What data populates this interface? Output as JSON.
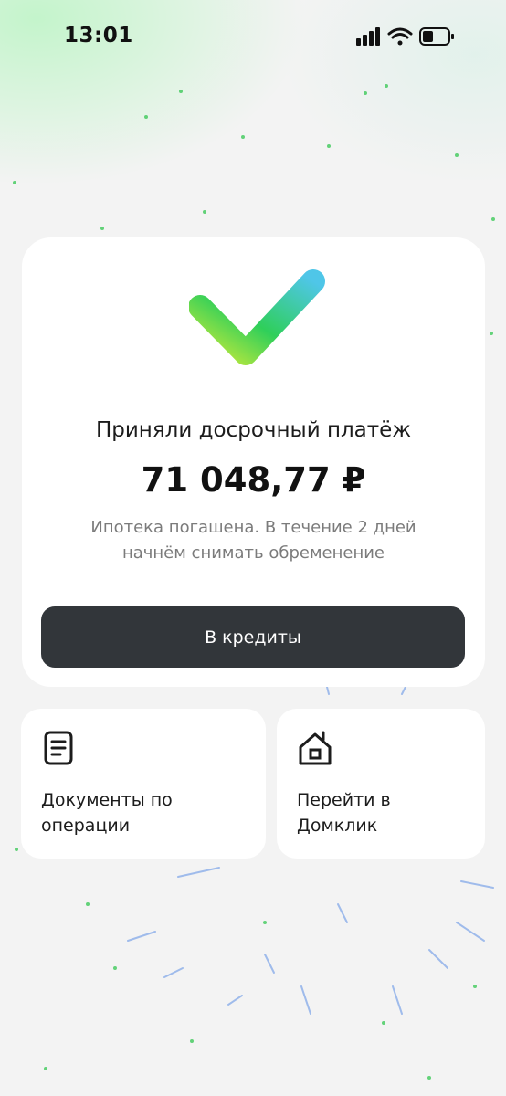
{
  "status_bar": {
    "time": "13:01",
    "icons": [
      "cellular-signal-icon",
      "wifi-icon",
      "battery-icon"
    ]
  },
  "payment_card": {
    "icon": "checkmark-icon",
    "title": "Приняли досрочный платёж",
    "amount": "71 048,77 ₽",
    "description_line1": "Ипотека погашена. В течение 2 дней",
    "description_line2": "начнём снимать обременение",
    "button_label": "В кредиты"
  },
  "tiles": [
    {
      "icon": "document-icon",
      "label_line1": "Документы по",
      "label_line2": "операции"
    },
    {
      "icon": "home-icon",
      "label_line1": "Перейти в",
      "label_line2": "Домклик"
    }
  ],
  "colors": {
    "background": "#f3f3f3",
    "card": "#ffffff",
    "button": "#32363a",
    "check_gradient_start": "#c8ea3a",
    "check_gradient_mid": "#2fcf5a",
    "check_gradient_end": "#4fc6e8",
    "particle_green": "#3ec95a",
    "particle_blue": "#5b8fe6"
  }
}
